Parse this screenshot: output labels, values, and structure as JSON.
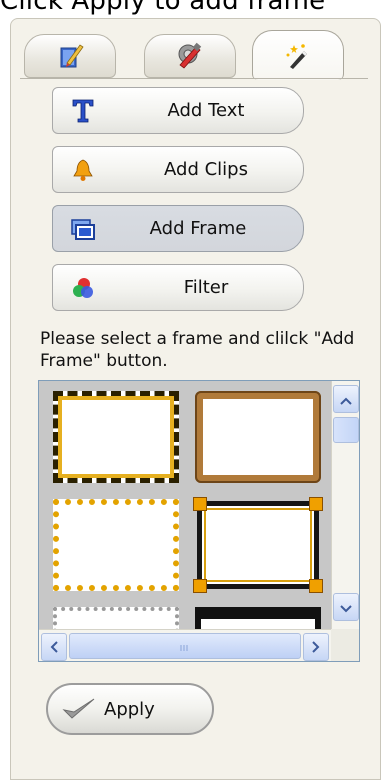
{
  "top_text": "Click Apply to add frame",
  "tabs": [
    {
      "name": "edit-tab",
      "icon": "pencil-paper-icon",
      "active": false
    },
    {
      "name": "tools-tab",
      "icon": "tools-icon",
      "active": false
    },
    {
      "name": "effects-tab",
      "icon": "magic-wand-icon",
      "active": true
    }
  ],
  "actions": {
    "add_text": {
      "label": "Add Text",
      "icon": "text-t-icon"
    },
    "add_clips": {
      "label": "Add Clips",
      "icon": "bell-clip-icon"
    },
    "add_frame": {
      "label": "Add Frame",
      "icon": "frame-icon",
      "pressed": true
    },
    "filter": {
      "label": "Filter",
      "icon": "color-balls-icon"
    }
  },
  "hint": "Please select a frame and clilck \"Add Frame\" button.",
  "frames": [
    {
      "name": "leopard-frame",
      "selected": false
    },
    {
      "name": "cork-frame",
      "selected": false
    },
    {
      "name": "gold-dots-frame",
      "selected": false
    },
    {
      "name": "black-gold-frame",
      "selected": true
    },
    {
      "name": "lace-frame",
      "selected": false
    },
    {
      "name": "film-frame",
      "selected": false
    }
  ],
  "apply": {
    "label": "Apply",
    "icon": "checkmark-icon"
  },
  "colors": {
    "accent": "#f0a000",
    "scroll": "#c6d6f5"
  }
}
